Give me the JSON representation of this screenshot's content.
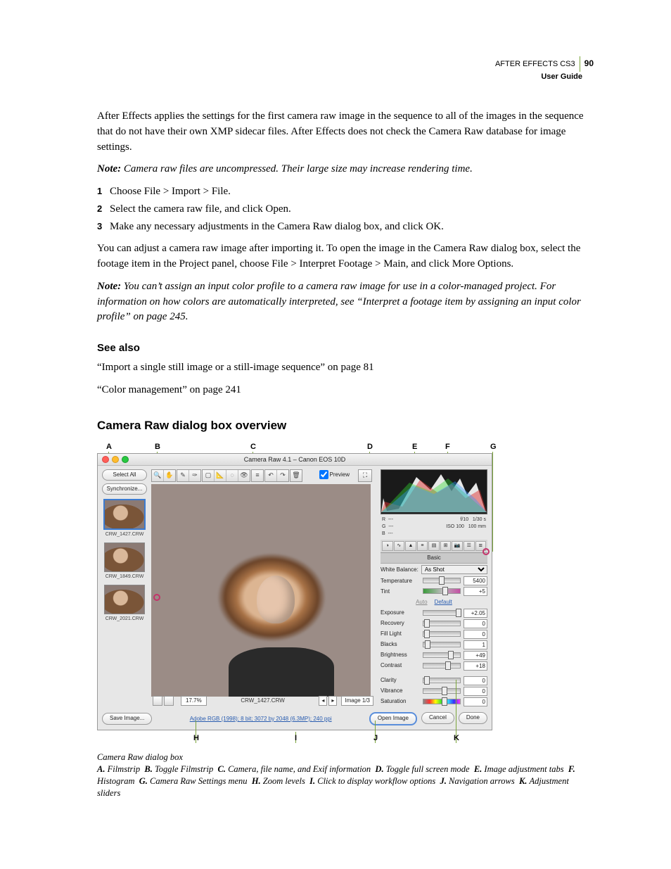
{
  "header": {
    "product": "AFTER EFFECTS CS3",
    "doc": "User Guide",
    "page": "90"
  },
  "p1": "After Effects applies the settings for the first camera raw image in the sequence to all of the images in the sequence that do not have their own XMP sidecar files. After Effects does not check the Camera Raw database for image settings.",
  "note1_lead": "Note:",
  "note1": " Camera raw files are uncompressed. Their large size may increase rendering time.",
  "steps": [
    "Choose File > Import > File.",
    "Select the camera raw file, and click Open.",
    "Make any necessary adjustments in the Camera Raw dialog box, and click OK."
  ],
  "p2": "You can adjust a camera raw image after importing it. To open the image in the Camera Raw dialog box, select the footage item in the Project panel, choose File > Interpret Footage > Main, and click More Options.",
  "note2_lead": "Note:",
  "note2": " You can’t assign an input color profile to a camera raw image for use in a color-managed project. For information on how colors are automatically interpreted, see “Interpret a footage item by assigning an input color profile” on page 245.",
  "see_also_h": "See also",
  "xref1": "“Import a single still image or a still-image sequence” on page 81",
  "xref2": "“Color management” on page 241",
  "h2": "Camera Raw dialog box overview",
  "callouts_top": {
    "A": "A",
    "B": "B",
    "C": "C",
    "D": "D",
    "E": "E",
    "F": "F",
    "G": "G"
  },
  "callouts_bot": {
    "H": "H",
    "I": "I",
    "J": "J",
    "K": "K"
  },
  "dialog": {
    "title": "Camera Raw 4.1  –  Canon EOS 10D",
    "select_all": "Select All",
    "synchronize": "Synchronize...",
    "thumbs": [
      "CRW_1427.CRW",
      "CRW_1849.CRW",
      "CRW_2021.CRW"
    ],
    "preview_label": "Preview",
    "zoom": "17.7%",
    "filename": "CRW_1427.CRW",
    "nav": "Image 1/3",
    "exif": {
      "left": "R  ---\nG  ---\nB  ---",
      "right": "f/10   1/30 s\nISO 100   100 mm"
    },
    "panel": "Basic",
    "wb_label": "White Balance:",
    "wb_value": "As Shot",
    "sliders": {
      "Temperature": "5400",
      "Tint": "+5",
      "Exposure": "+2.05",
      "Recovery": "0",
      "Fill Light": "0",
      "Blacks": "1",
      "Brightness": "+49",
      "Contrast": "+18",
      "Clarity": "0",
      "Vibrance": "0",
      "Saturation": "0"
    },
    "auto": "Auto",
    "default": "Default",
    "save": "Save Image...",
    "workflow": "Adobe RGB (1998); 8 bit; 3072 by 2048 (6.3MP); 240 ppi",
    "open": "Open Image",
    "cancel": "Cancel",
    "done": "Done"
  },
  "caption_title": "Camera Raw dialog box",
  "legend": [
    [
      "A.",
      "Filmstrip"
    ],
    [
      "B.",
      "Toggle Filmstrip"
    ],
    [
      "C.",
      "Camera, file name, and Exif information"
    ],
    [
      "D.",
      "Toggle full screen mode"
    ],
    [
      "E.",
      "Image adjustment tabs"
    ],
    [
      "F.",
      "Histogram"
    ],
    [
      "G.",
      "Camera Raw Settings menu"
    ],
    [
      "H.",
      "Zoom levels"
    ],
    [
      "I.",
      "Click to display workflow options"
    ],
    [
      "J.",
      "Navigation arrows"
    ],
    [
      "K.",
      "Adjustment sliders"
    ]
  ]
}
